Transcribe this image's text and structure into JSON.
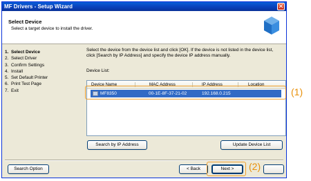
{
  "window": {
    "title": "MF Drivers - Setup Wizard",
    "close_label": "✕"
  },
  "header": {
    "title": "Select Device",
    "subtitle": "Select a target device to install the driver."
  },
  "steps": [
    {
      "num": "1.",
      "label": "Select Device",
      "active": true
    },
    {
      "num": "2.",
      "label": "Select Driver"
    },
    {
      "num": "3.",
      "label": "Confirm Settings"
    },
    {
      "num": "4.",
      "label": "Install"
    },
    {
      "num": "5.",
      "label": "Set Default Printer"
    },
    {
      "num": "6.",
      "label": "Print Test Page"
    },
    {
      "num": "7.",
      "label": "Exit"
    }
  ],
  "main": {
    "instruction": "Select the device from the device list and click [OK]. If the device is not listed in the device list, click [Search by IP Address] and specify the device IP address manually.",
    "device_list_label": "Device List:",
    "columns": [
      "Device Name",
      "MAC Address",
      "IP Address",
      "Location"
    ],
    "rows": [
      {
        "device_name": "MF8350",
        "mac": "00-1E-8F-37-21-02",
        "ip": "192.168.0.215",
        "location": ""
      }
    ],
    "search_ip_button": "Search by IP Address",
    "update_list_button": "Update Device List"
  },
  "footer": {
    "search_option": "Search Option",
    "back": "< Back",
    "next": "Next >",
    "cancel": ""
  },
  "callouts": {
    "one": "(1)",
    "two": "(2)"
  },
  "colors": {
    "selection": "#316ac5",
    "callout": "#e8900a",
    "titlebar": "#0a3fb8"
  }
}
